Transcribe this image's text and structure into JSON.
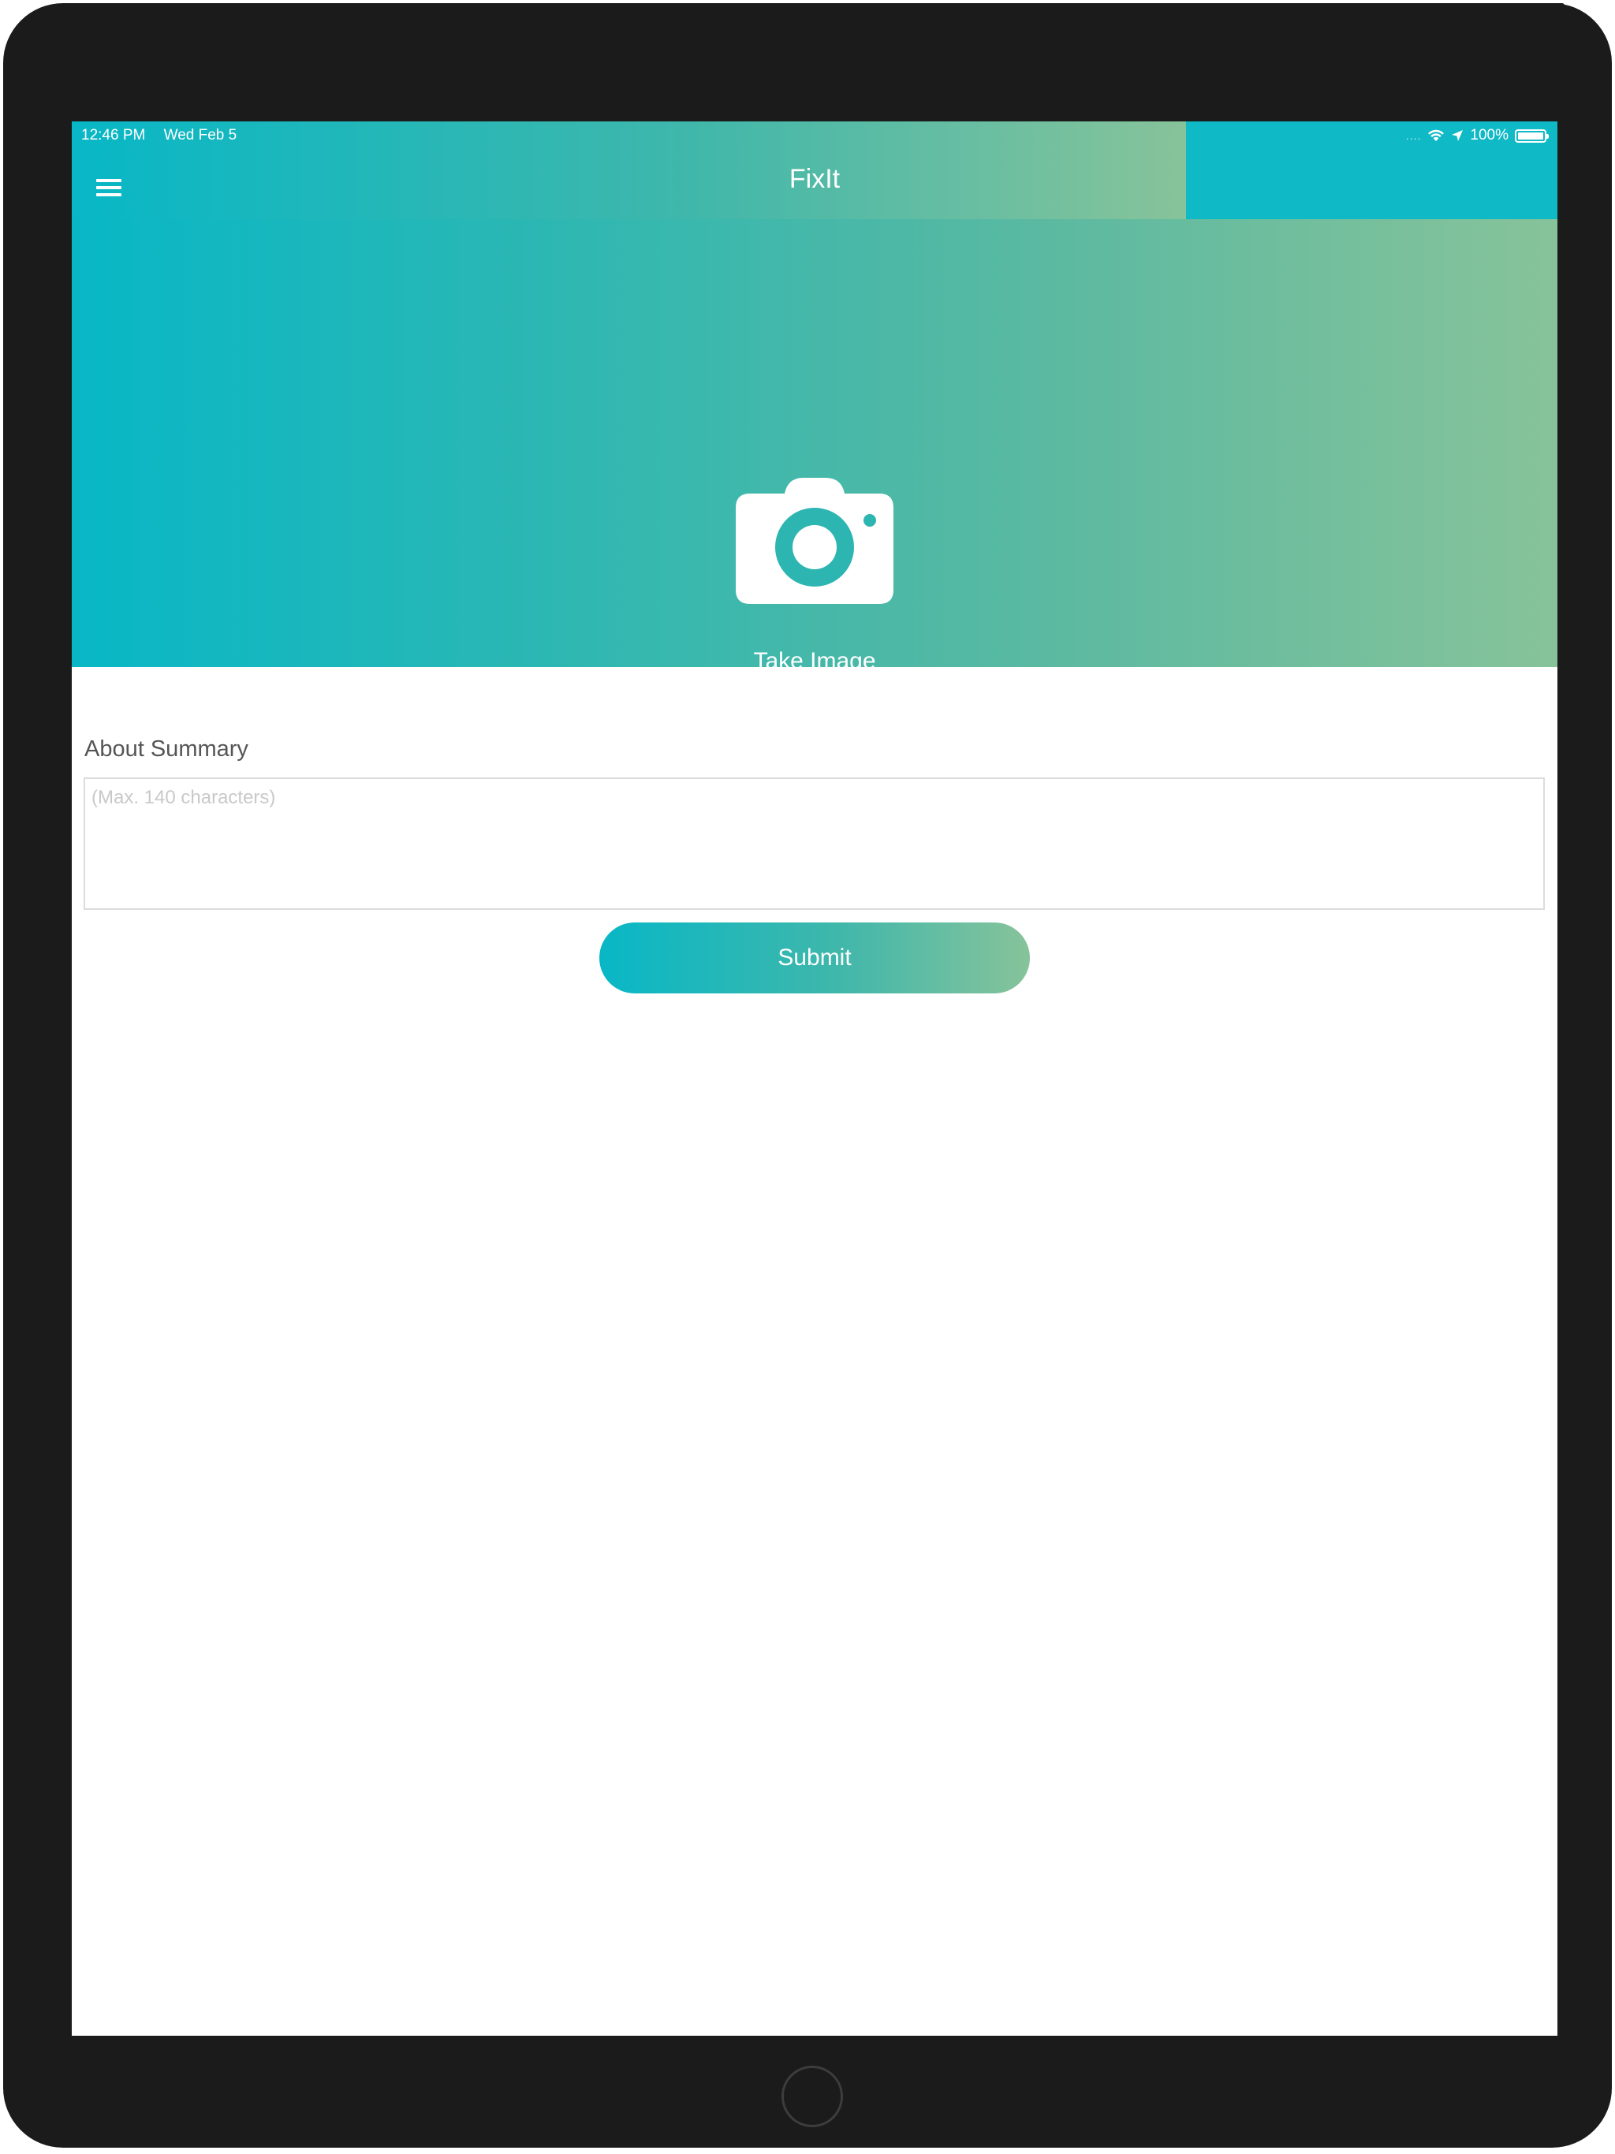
{
  "status_bar": {
    "time": "12:46 PM",
    "date": "Wed Feb 5",
    "signal": "....",
    "battery": "100%"
  },
  "nav": {
    "title": "FixIt",
    "menu_icon": "hamburger-menu-icon"
  },
  "hero": {
    "camera_icon": "camera-icon",
    "take_image_label": "Take Image"
  },
  "form": {
    "summary_label": "About Summary",
    "summary_placeholder": "(Max. 140 characters)",
    "summary_value": "",
    "submit_label": "Submit"
  },
  "colors": {
    "gradient_start": "#08b7c6",
    "gradient_end": "#87c39a",
    "nav_right": "#0fb9c6",
    "device_frame": "#1b1b1b"
  }
}
